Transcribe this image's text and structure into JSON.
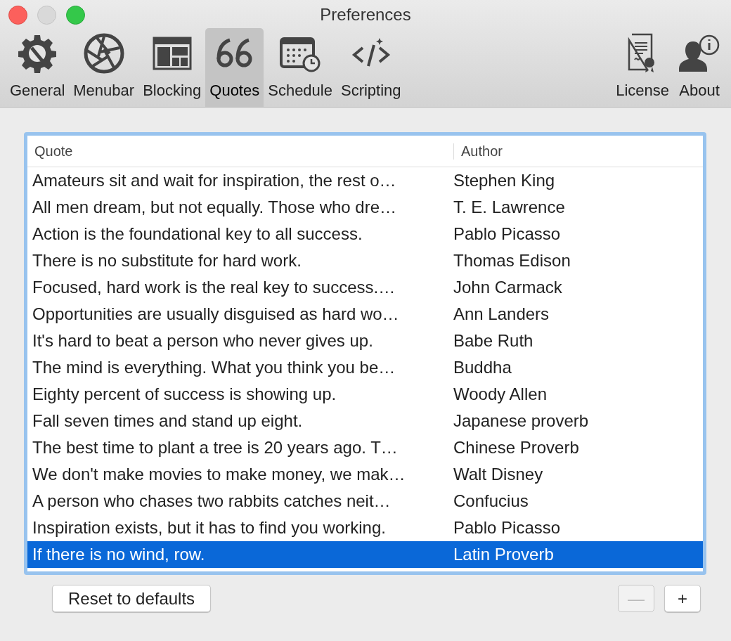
{
  "window": {
    "title": "Preferences"
  },
  "toolbar": [
    {
      "label": "General",
      "selected": false
    },
    {
      "label": "Menubar",
      "selected": false
    },
    {
      "label": "Blocking",
      "selected": false
    },
    {
      "label": "Quotes",
      "selected": true
    },
    {
      "label": "Schedule",
      "selected": false
    },
    {
      "label": "Scripting",
      "selected": false
    },
    {
      "label": "License",
      "selected": false
    },
    {
      "label": "About",
      "selected": false
    }
  ],
  "table": {
    "columns": [
      "Quote",
      "Author"
    ],
    "rows": [
      {
        "quote": "Amateurs sit and wait for inspiration, the rest o…",
        "author": "Stephen King",
        "selected": false
      },
      {
        "quote": "All men dream, but not equally. Those who dre…",
        "author": "T. E. Lawrence",
        "selected": false
      },
      {
        "quote": "Action is the foundational key to all success.",
        "author": "Pablo Picasso",
        "selected": false
      },
      {
        "quote": "There is no substitute for hard work.",
        "author": "Thomas Edison",
        "selected": false
      },
      {
        "quote": "Focused, hard work is the real key to success.…",
        "author": "John Carmack",
        "selected": false
      },
      {
        "quote": "Opportunities are usually disguised as hard wo…",
        "author": "Ann Landers",
        "selected": false
      },
      {
        "quote": "It's hard to beat a person who never gives up.",
        "author": "Babe Ruth",
        "selected": false
      },
      {
        "quote": "The mind is everything. What you think you be…",
        "author": "Buddha",
        "selected": false
      },
      {
        "quote": "Eighty percent of success is showing up.",
        "author": "Woody Allen",
        "selected": false
      },
      {
        "quote": "Fall seven times and stand up eight.",
        "author": "Japanese proverb",
        "selected": false
      },
      {
        "quote": "The best time to plant a tree is 20 years ago. T…",
        "author": "Chinese Proverb",
        "selected": false
      },
      {
        "quote": "We don't make movies to make money, we mak…",
        "author": "Walt Disney",
        "selected": false
      },
      {
        "quote": "A person who chases two rabbits catches neit…",
        "author": "Confucius",
        "selected": false
      },
      {
        "quote": "Inspiration exists, but it has to find you working.",
        "author": "Pablo Picasso",
        "selected": false
      },
      {
        "quote": "If there is no wind, row.",
        "author": "Latin Proverb",
        "selected": true
      }
    ]
  },
  "buttons": {
    "reset": {
      "label": "Reset to defaults"
    },
    "remove": {
      "label": "—",
      "disabled": true
    },
    "add": {
      "label": "+",
      "disabled": false
    }
  }
}
